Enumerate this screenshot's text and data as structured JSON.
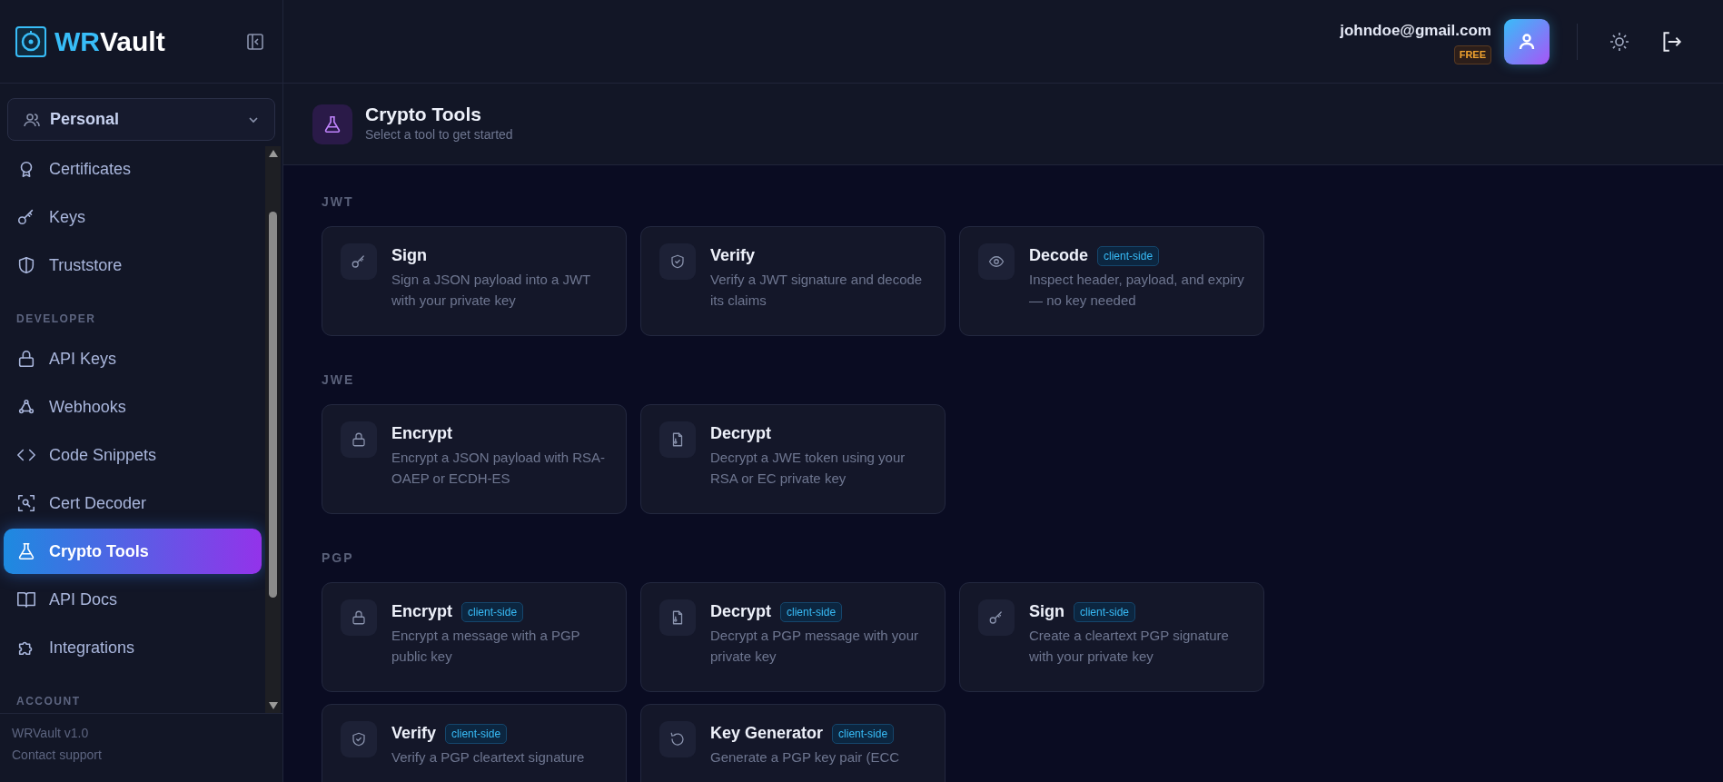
{
  "sidebar": {
    "logo": {
      "accent": "WR",
      "rest": "Vault"
    },
    "workspace": {
      "label": "Personal"
    },
    "nav": [
      {
        "kind": "item",
        "label": "Certificates",
        "selected": false
      },
      {
        "kind": "item",
        "label": "Keys",
        "selected": false
      },
      {
        "kind": "item",
        "label": "Truststore",
        "selected": false
      },
      {
        "kind": "heading",
        "label": "DEVELOPER"
      },
      {
        "kind": "item",
        "label": "API Keys",
        "selected": false
      },
      {
        "kind": "item",
        "label": "Webhooks",
        "selected": false
      },
      {
        "kind": "item",
        "label": "Code Snippets",
        "selected": false
      },
      {
        "kind": "item",
        "label": "Cert Decoder",
        "selected": false
      },
      {
        "kind": "item",
        "label": "Crypto Tools",
        "selected": true
      },
      {
        "kind": "item",
        "label": "API Docs",
        "selected": false
      },
      {
        "kind": "item",
        "label": "Integrations",
        "selected": false
      },
      {
        "kind": "heading",
        "label": "ACCOUNT"
      }
    ],
    "footer": {
      "version": "WRVault v1.0",
      "support": "Contact support"
    }
  },
  "header": {
    "email": "johndoe@gmail.com",
    "plan": "FREE"
  },
  "page": {
    "title": "Crypto Tools",
    "subtitle": "Select a tool to get started"
  },
  "sections": [
    {
      "label": "JWT",
      "tools": [
        {
          "title": "Sign",
          "description": "Sign a JSON payload into a JWT with your private key"
        },
        {
          "title": "Verify",
          "description": "Verify a JWT signature and decode its claims"
        },
        {
          "title": "Decode",
          "badge": "client-side",
          "description": "Inspect header, payload, and expiry — no key needed"
        }
      ]
    },
    {
      "label": "JWE",
      "tools": [
        {
          "title": "Encrypt",
          "description": "Encrypt a JSON payload with RSA-OAEP or ECDH-ES"
        },
        {
          "title": "Decrypt",
          "description": "Decrypt a JWE token using your RSA or EC private key"
        }
      ]
    },
    {
      "label": "PGP",
      "tools": [
        {
          "title": "Encrypt",
          "badge": "client-side",
          "description": "Encrypt a message with a PGP public key"
        },
        {
          "title": "Decrypt",
          "badge": "client-side",
          "description": "Decrypt a PGP message with your private key"
        },
        {
          "title": "Sign",
          "badge": "client-side",
          "description": "Create a cleartext PGP signature with your private key"
        },
        {
          "title": "Verify",
          "badge": "client-side",
          "description": "Verify a PGP cleartext signature"
        },
        {
          "title": "Key Generator",
          "badge": "client-side",
          "description": "Generate a PGP key pair (ECC"
        }
      ]
    }
  ]
}
